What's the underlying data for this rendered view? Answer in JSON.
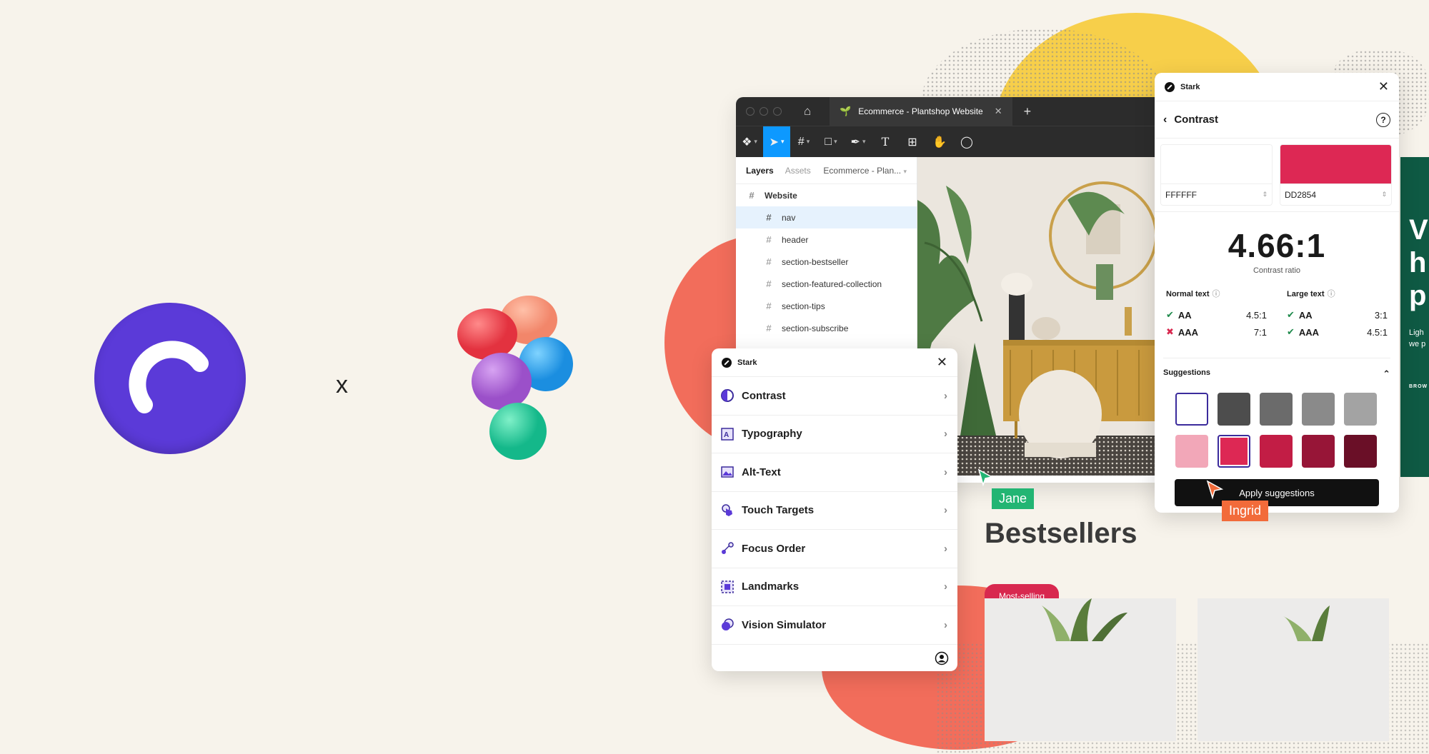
{
  "figma": {
    "tab_title": "Ecommerce - Plantshop Website",
    "layers_tab": "Layers",
    "assets_tab": "Assets",
    "page_select": "Ecommerce - Plan...",
    "layers": [
      {
        "label": "Website"
      },
      {
        "label": "nav"
      },
      {
        "label": "header"
      },
      {
        "label": "section-bestseller"
      },
      {
        "label": "section-featured-collection"
      },
      {
        "label": "section-tips"
      },
      {
        "label": "section-subscribe"
      }
    ]
  },
  "logos": {
    "separator": "x"
  },
  "canvas": {
    "heading": "Bestsellers",
    "badge": "Most-selling",
    "side_text": {
      "big1": "V",
      "big2": "h",
      "big3": "p",
      "small1": "Ligh",
      "small2": "we p",
      "link": "BROW"
    }
  },
  "cursors": {
    "jane": "Jane",
    "ingrid": "Ingrid",
    "jane_color": "#22b573",
    "ingrid_color": "#f26b3a"
  },
  "stark_list": {
    "title": "Stark",
    "items": [
      {
        "label": "Contrast",
        "icon": "contrast-icon"
      },
      {
        "label": "Typography",
        "icon": "typography-icon"
      },
      {
        "label": "Alt-Text",
        "icon": "alt-text-icon"
      },
      {
        "label": "Touch Targets",
        "icon": "touch-targets-icon"
      },
      {
        "label": "Focus Order",
        "icon": "focus-order-icon"
      },
      {
        "label": "Landmarks",
        "icon": "landmarks-icon"
      },
      {
        "label": "Vision Simulator",
        "icon": "vision-simulator-icon"
      }
    ]
  },
  "stark_contrast": {
    "title": "Stark",
    "section": "Contrast",
    "foreground_hex": "FFFFFF",
    "background_hex": "DD2854",
    "ratio": "4.66:1",
    "ratio_label": "Contrast ratio",
    "normal_text": {
      "title": "Normal text",
      "rows": [
        {
          "level": "AA",
          "target": "4.5:1",
          "pass": true
        },
        {
          "level": "AAA",
          "target": "7:1",
          "pass": false
        }
      ]
    },
    "large_text": {
      "title": "Large text",
      "rows": [
        {
          "level": "AA",
          "target": "3:1",
          "pass": true
        },
        {
          "level": "AAA",
          "target": "4.5:1",
          "pass": true
        }
      ]
    },
    "suggestions_title": "Suggestions",
    "suggestions": [
      "#ffffff",
      "#4d4d4d",
      "#6b6b6b",
      "#8a8a8a",
      "#a3a3a3",
      "#f2a7b8",
      "#dd2854",
      "#c21d45",
      "#971537",
      "#6a0f27"
    ],
    "apply_label": "Apply suggestions"
  },
  "colors": {
    "stark_purple": "#5b3ad8",
    "brand_red": "#dd2854",
    "figma_blue": "#0d99ff",
    "blob_coral": "#f26d5b",
    "blob_yellow": "#f7cf4a"
  }
}
